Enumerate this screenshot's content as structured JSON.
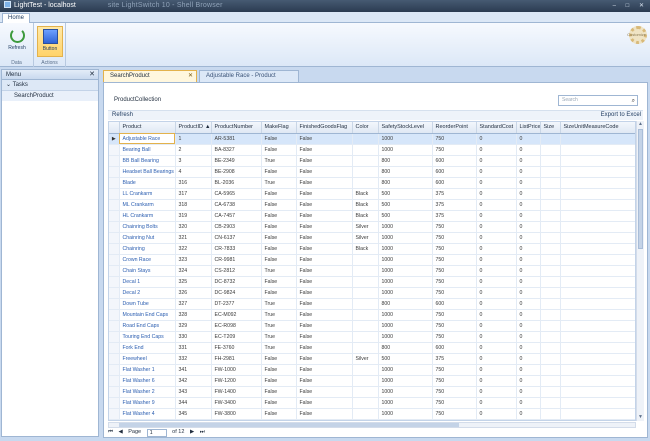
{
  "window": {
    "title": "LightTest - localhost",
    "blurred_text": "site LightSwitch 10 - Shell Browser",
    "controls": [
      "Minimize",
      "Maximize",
      "Close"
    ]
  },
  "ribbon": {
    "tab": "Home",
    "groups": [
      {
        "label": "Data",
        "buttons": [
          {
            "label": "Refresh",
            "icon": "refresh-icon"
          }
        ]
      },
      {
        "label": "Actions",
        "buttons": [
          {
            "label": "Button",
            "icon": "button-icon"
          }
        ]
      }
    ],
    "customize": "Customize"
  },
  "menu": {
    "title": "Menu",
    "section": "Tasks",
    "items": [
      "SearchProduct"
    ]
  },
  "tabs": [
    {
      "label": "SearchProduct"
    },
    {
      "label": "Adjustable Race - Product"
    }
  ],
  "screen": {
    "collection_label": "ProductCollection",
    "search_placeholder": "Search",
    "refresh_label": "Refresh",
    "export_label": "Export to Excel"
  },
  "grid": {
    "columns": [
      "Product",
      "ProductID",
      "ProductNumber",
      "MakeFlag",
      "FinishedGoodsFlag",
      "Color",
      "SafetyStockLevel",
      "ReorderPoint",
      "StandardCost",
      "ListPrice",
      "Size",
      "SizeUnitMeasureCode"
    ],
    "sort_column": "ProductID",
    "sort_indicator": "▲",
    "rows": [
      [
        "Adjustable Race",
        "1",
        "AR-5381",
        "False",
        "False",
        "",
        "1000",
        "750",
        "0",
        "0",
        "",
        ""
      ],
      [
        "Bearing Ball",
        "2",
        "BA-8327",
        "False",
        "False",
        "",
        "1000",
        "750",
        "0",
        "0",
        "",
        ""
      ],
      [
        "BB Ball Bearing",
        "3",
        "BE-2349",
        "True",
        "False",
        "",
        "800",
        "600",
        "0",
        "0",
        "",
        ""
      ],
      [
        "Headset Ball Bearings",
        "4",
        "BE-2908",
        "False",
        "False",
        "",
        "800",
        "600",
        "0",
        "0",
        "",
        ""
      ],
      [
        "Blade",
        "316",
        "BL-2036",
        "True",
        "False",
        "",
        "800",
        "600",
        "0",
        "0",
        "",
        ""
      ],
      [
        "LL Crankarm",
        "317",
        "CA-5965",
        "False",
        "False",
        "Black",
        "500",
        "375",
        "0",
        "0",
        "",
        ""
      ],
      [
        "ML Crankarm",
        "318",
        "CA-6738",
        "False",
        "False",
        "Black",
        "500",
        "375",
        "0",
        "0",
        "",
        ""
      ],
      [
        "HL Crankarm",
        "319",
        "CA-7457",
        "False",
        "False",
        "Black",
        "500",
        "375",
        "0",
        "0",
        "",
        ""
      ],
      [
        "Chainring Bolts",
        "320",
        "CB-2903",
        "False",
        "False",
        "Silver",
        "1000",
        "750",
        "0",
        "0",
        "",
        ""
      ],
      [
        "Chainring Nut",
        "321",
        "CN-6137",
        "False",
        "False",
        "Silver",
        "1000",
        "750",
        "0",
        "0",
        "",
        ""
      ],
      [
        "Chainring",
        "322",
        "CR-7833",
        "False",
        "False",
        "Black",
        "1000",
        "750",
        "0",
        "0",
        "",
        ""
      ],
      [
        "Crown Race",
        "323",
        "CR-9981",
        "False",
        "False",
        "",
        "1000",
        "750",
        "0",
        "0",
        "",
        ""
      ],
      [
        "Chain Stays",
        "324",
        "CS-2812",
        "True",
        "False",
        "",
        "1000",
        "750",
        "0",
        "0",
        "",
        ""
      ],
      [
        "Decal 1",
        "325",
        "DC-8732",
        "False",
        "False",
        "",
        "1000",
        "750",
        "0",
        "0",
        "",
        ""
      ],
      [
        "Decal 2",
        "326",
        "DC-9824",
        "False",
        "False",
        "",
        "1000",
        "750",
        "0",
        "0",
        "",
        ""
      ],
      [
        "Down Tube",
        "327",
        "DT-2377",
        "True",
        "False",
        "",
        "800",
        "600",
        "0",
        "0",
        "",
        ""
      ],
      [
        "Mountain End Caps",
        "328",
        "EC-M092",
        "True",
        "False",
        "",
        "1000",
        "750",
        "0",
        "0",
        "",
        ""
      ],
      [
        "Road End Caps",
        "329",
        "EC-R098",
        "True",
        "False",
        "",
        "1000",
        "750",
        "0",
        "0",
        "",
        ""
      ],
      [
        "Touring End Caps",
        "330",
        "EC-T209",
        "True",
        "False",
        "",
        "1000",
        "750",
        "0",
        "0",
        "",
        ""
      ],
      [
        "Fork End",
        "331",
        "FE-3760",
        "True",
        "False",
        "",
        "800",
        "600",
        "0",
        "0",
        "",
        ""
      ],
      [
        "Freewheel",
        "332",
        "FH-2981",
        "False",
        "False",
        "Silver",
        "500",
        "375",
        "0",
        "0",
        "",
        ""
      ],
      [
        "Flat Washer 1",
        "341",
        "FW-1000",
        "False",
        "False",
        "",
        "1000",
        "750",
        "0",
        "0",
        "",
        ""
      ],
      [
        "Flat Washer 6",
        "342",
        "FW-1200",
        "False",
        "False",
        "",
        "1000",
        "750",
        "0",
        "0",
        "",
        ""
      ],
      [
        "Flat Washer 2",
        "343",
        "FW-1400",
        "False",
        "False",
        "",
        "1000",
        "750",
        "0",
        "0",
        "",
        ""
      ],
      [
        "Flat Washer 9",
        "344",
        "FW-3400",
        "False",
        "False",
        "",
        "1000",
        "750",
        "0",
        "0",
        "",
        ""
      ],
      [
        "Flat Washer 4",
        "345",
        "FW-3800",
        "False",
        "False",
        "",
        "1000",
        "750",
        "0",
        "0",
        "",
        ""
      ]
    ]
  },
  "pager": {
    "first": "⏮",
    "prev": "◀",
    "page_label": "Page",
    "page_value": "1",
    "of_label": "of 12",
    "next": "▶",
    "last": "⏭"
  }
}
